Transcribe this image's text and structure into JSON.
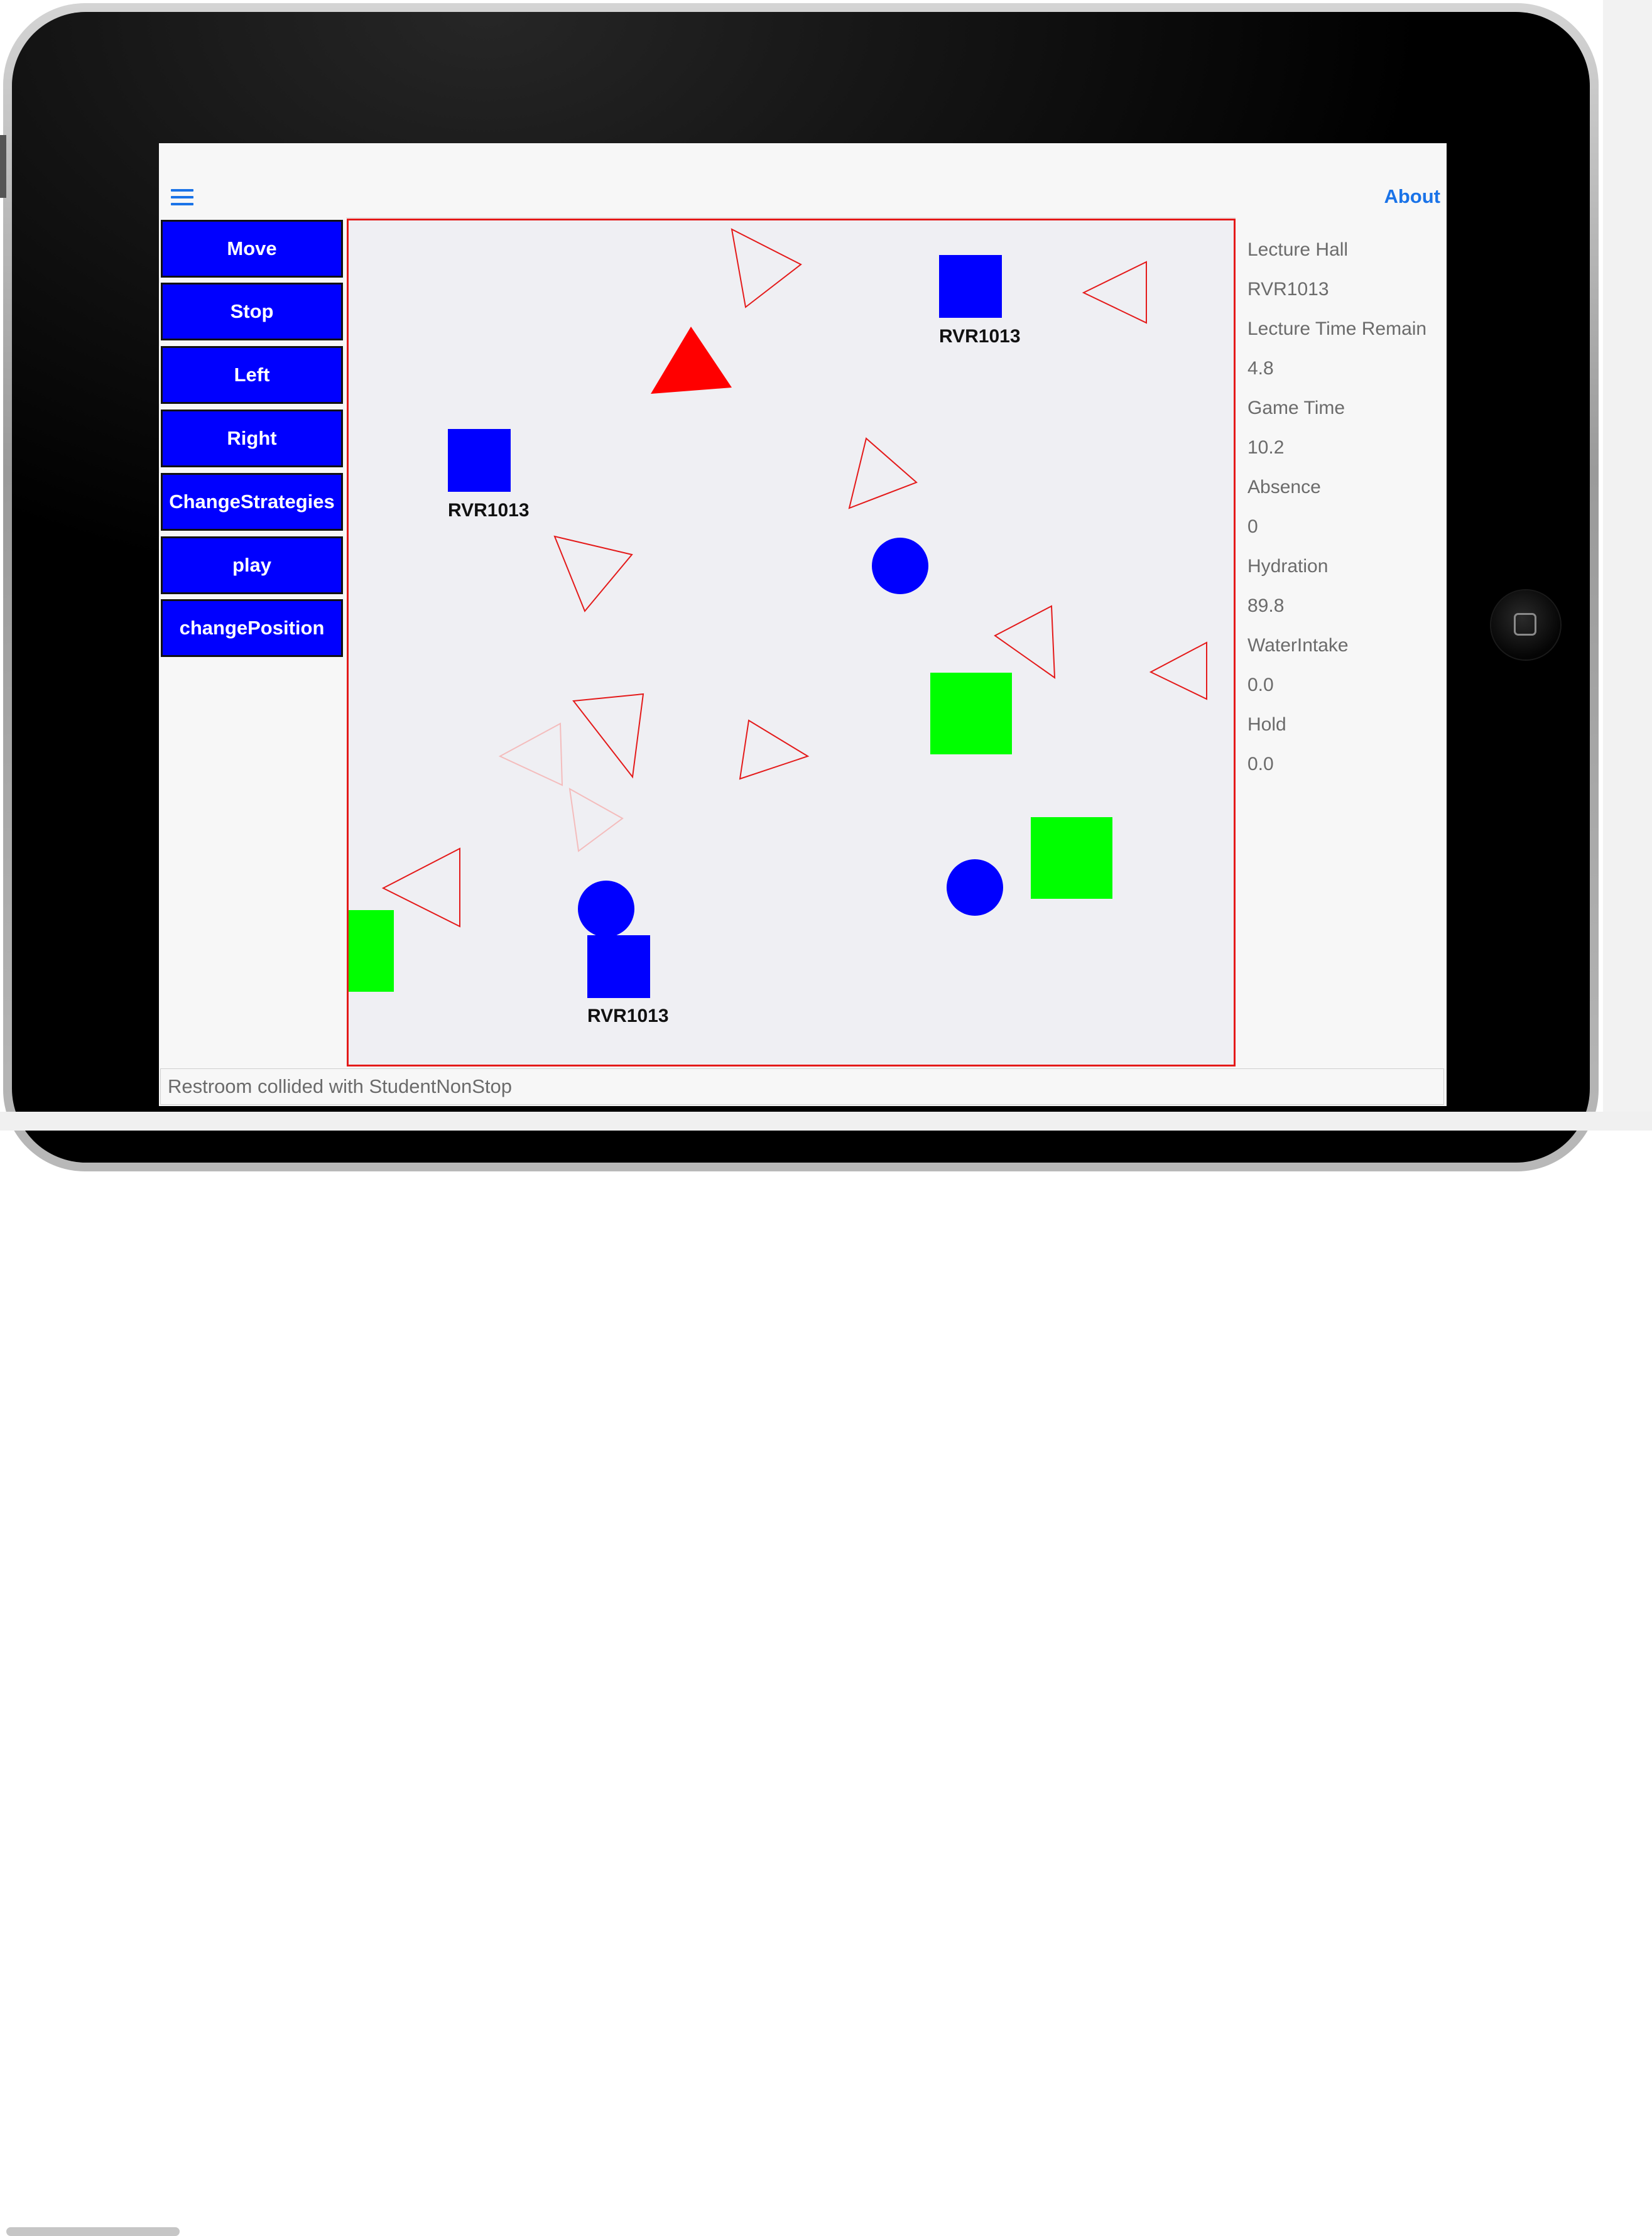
{
  "toolbar": {
    "menu_icon": "hamburger-menu-icon",
    "about_label": "About",
    "accent_color": "#1a73e8"
  },
  "commands": [
    {
      "label": "Move"
    },
    {
      "label": "Stop"
    },
    {
      "label": "Left"
    },
    {
      "label": "Right"
    },
    {
      "label": "ChangeStrategies"
    },
    {
      "label": "play"
    },
    {
      "label": "changePosition"
    }
  ],
  "info_panel": [
    {
      "text": "Lecture Hall"
    },
    {
      "text": "RVR1013"
    },
    {
      "text": "Lecture Time Remain"
    },
    {
      "text": "4.8"
    },
    {
      "text": "Game Time"
    },
    {
      "text": "10.2"
    },
    {
      "text": "Absence"
    },
    {
      "text": "0"
    },
    {
      "text": "Hydration"
    },
    {
      "text": "89.8"
    },
    {
      "text": "WaterIntake"
    },
    {
      "text": "0.0"
    },
    {
      "text": "Hold"
    },
    {
      "text": "0.0"
    }
  ],
  "game_map": {
    "colors": {
      "border": "#e41a1a",
      "lecture_hall": "#0000ff",
      "student": "#0000ff",
      "restroom": "#00ff00",
      "player": "#ff0000",
      "outline_triangle": "#e41a1a"
    },
    "lecture_hall_labels": [
      "RVR1013",
      "RVR1013",
      "RVR1013"
    ]
  },
  "status_bar": {
    "message": "Restroom collided with StudentNonStop"
  }
}
